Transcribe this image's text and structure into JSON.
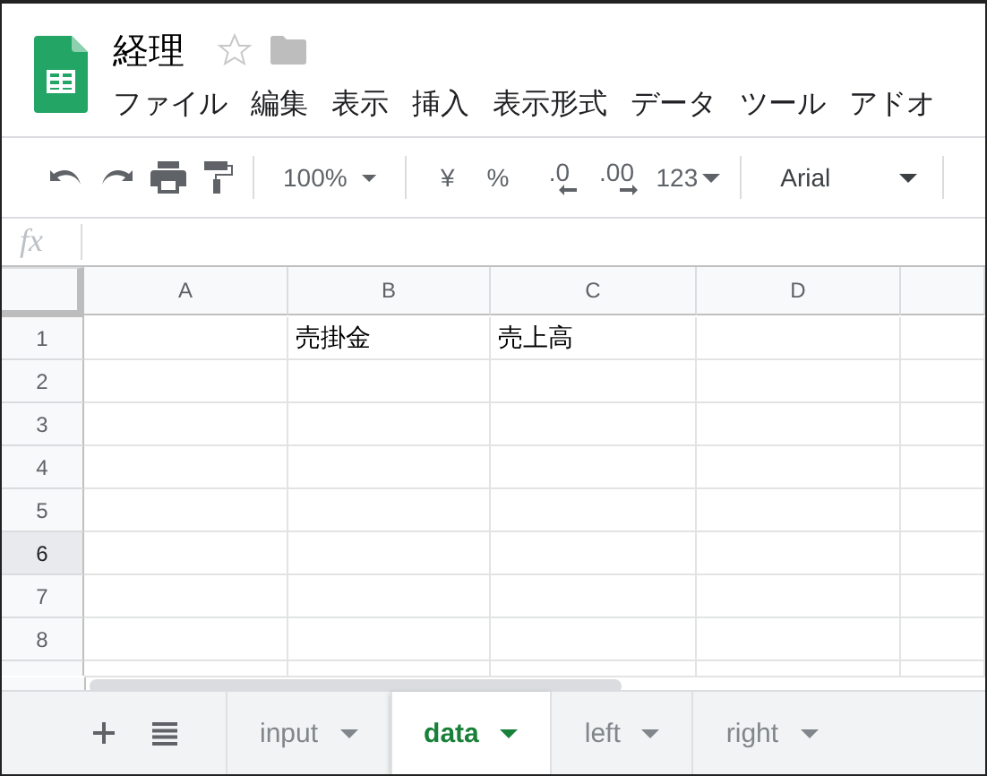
{
  "document": {
    "title": "経理",
    "starred": false
  },
  "menu": [
    "ファイル",
    "編集",
    "表示",
    "挿入",
    "表示形式",
    "データ",
    "ツール",
    "アドオ"
  ],
  "toolbar": {
    "zoom": "100%",
    "currency": "¥",
    "percent": "%",
    "decrease_decimal": ".0",
    "increase_decimal": ".00",
    "number_format": "123",
    "font": "Arial"
  },
  "formula_bar": {
    "label": "fx"
  },
  "columns": [
    "A",
    "B",
    "C",
    "D"
  ],
  "rows": [
    {
      "number": "1",
      "selected": false,
      "cells": [
        null,
        "売掛金",
        "売上高",
        null
      ]
    },
    {
      "number": "2",
      "selected": false,
      "cells": []
    },
    {
      "number": "3",
      "selected": false,
      "cells": []
    },
    {
      "number": "4",
      "selected": false,
      "cells": []
    },
    {
      "number": "5",
      "selected": false,
      "cells": []
    },
    {
      "number": "6",
      "selected": true,
      "cells": []
    },
    {
      "number": "7",
      "selected": false,
      "cells": []
    },
    {
      "number": "8",
      "selected": false,
      "cells": []
    }
  ],
  "sheet_tabs": [
    {
      "label": "input",
      "selected": false
    },
    {
      "label": "data",
      "selected": true
    },
    {
      "label": "left",
      "selected": false
    },
    {
      "label": "right",
      "selected": false
    }
  ]
}
